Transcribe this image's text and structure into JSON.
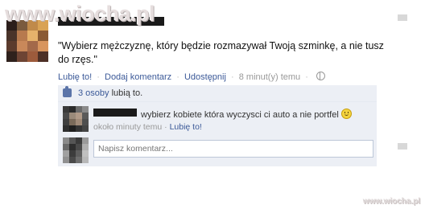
{
  "watermark": {
    "text": "www.wiocha.pl",
    "small": "www.wiocha.pl"
  },
  "post": {
    "status": "\"Wybierz mężczyznę, który będzie rozmazywał Twoją szminkę, a nie tusz do rzęs.\"",
    "actions": {
      "like": "Lubię to!",
      "comment": "Dodaj komentarz",
      "share": "Udostępnij",
      "time": "8 minut(y) temu",
      "separator": "·"
    }
  },
  "likes": {
    "count": "3 osoby",
    "suffix": "lubią to."
  },
  "comment": {
    "text": "wybierz kobiete która wyczysci ci auto a nie portfel",
    "time": "około minuty temu",
    "like": "Lubię to!",
    "separator": "·"
  },
  "write_comment": {
    "placeholder": "Napisz komentarz..."
  },
  "colors": {
    "link": "#3b5998",
    "ufi_background": "#eceff5",
    "muted_text": "#999999",
    "input_border": "#bdc7d8"
  }
}
